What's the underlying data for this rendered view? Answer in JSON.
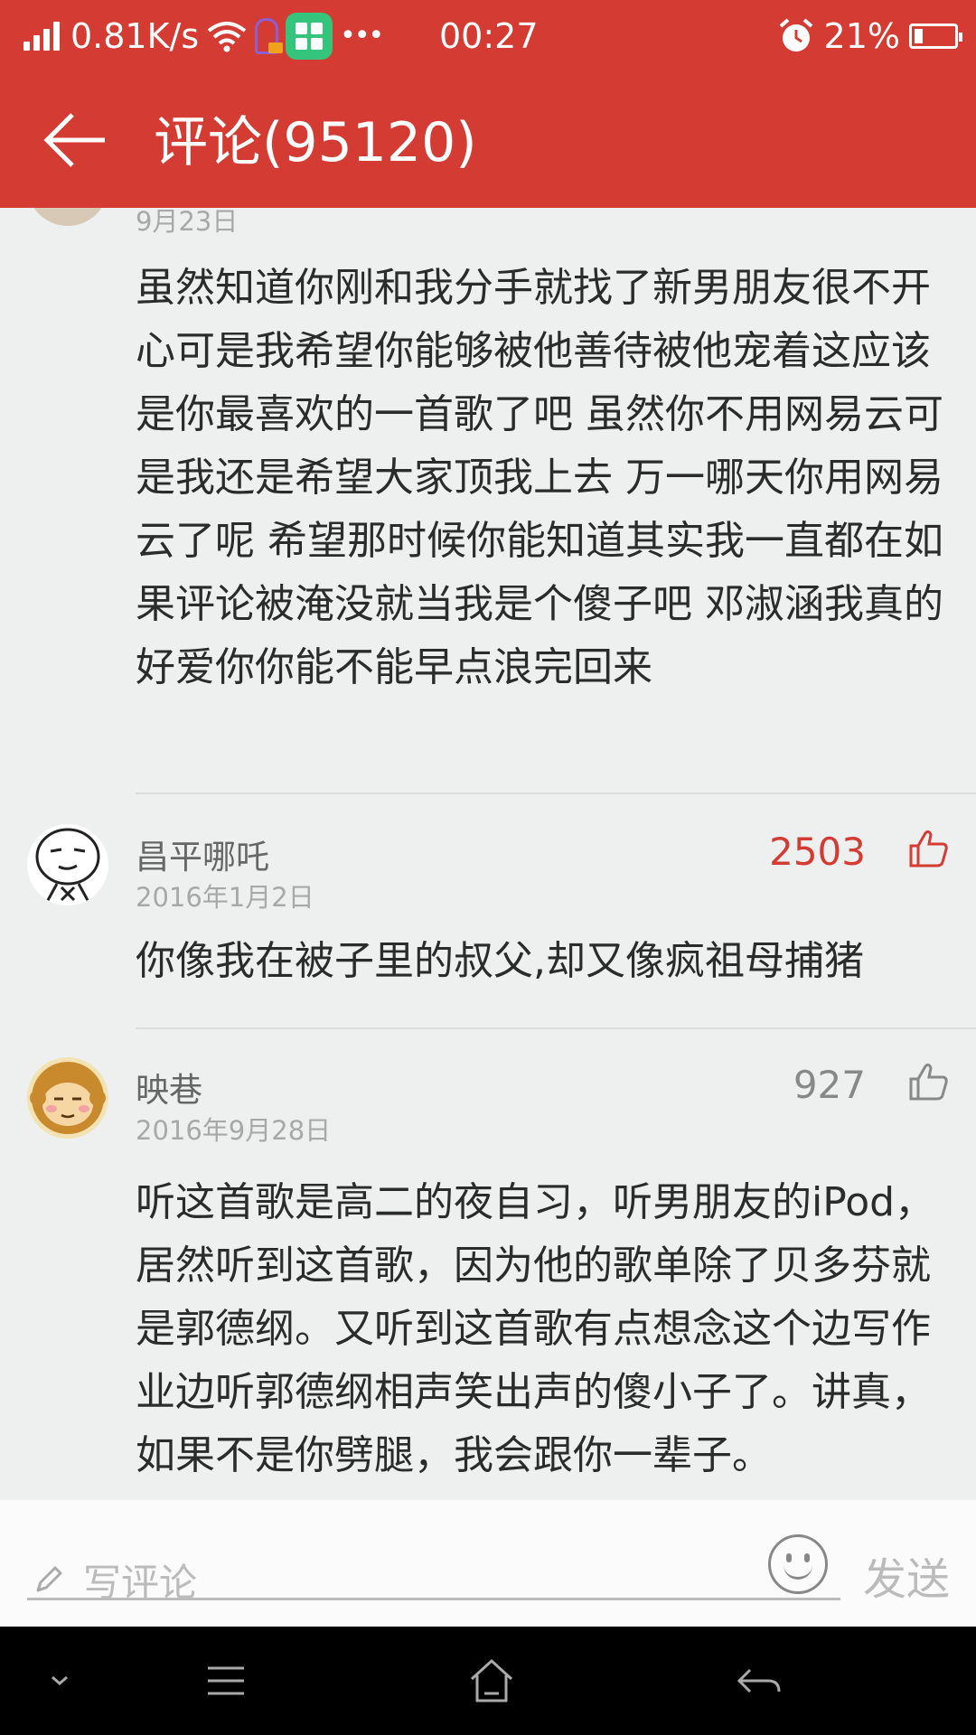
{
  "status_bar": {
    "net_speed": "0.81K/s",
    "more": "•••",
    "time": "00:27",
    "battery": "21%"
  },
  "header": {
    "title": "评论(95120)",
    "back_icon": "arrow-left-icon"
  },
  "comments": [
    {
      "date": "9月23日",
      "text": "虽然知道你刚和我分手就找了新男朋友很不开心可是我希望你能够被他善待被他宠着这应该是你最喜欢的一首歌了吧 虽然你不用网易云可是我还是希望大家顶我上去 万一哪天你用网易云了呢 希望那时候你能知道其实我一直都在如果评论被淹没就当我是个傻子吧 邓淑涵我真的好爱你你能不能早点浪完回来"
    },
    {
      "name": "昌平哪吒",
      "date": "2016年1月2日",
      "likes": "2503",
      "liked": true,
      "text": "你像我在被子里的叔父,却又像疯祖母捕猪"
    },
    {
      "name": "映巷",
      "date": "2016年9月28日",
      "likes": "927",
      "liked": false,
      "text": "听这首歌是高二的夜自习，听男朋友的iPod，居然听到这首歌，因为他的歌单除了贝多芬就是郭德纲。又听到这首歌有点想念这个边写作业边听郭德纲相声笑出声的傻小子了。讲真，如果不是你劈腿，我会跟你一辈子。"
    }
  ],
  "input_bar": {
    "placeholder": "写评论",
    "send_label": "发送"
  },
  "colors": {
    "brand_red": "#d43b33",
    "liked_red": "#d43b33",
    "like_gray": "#888888"
  }
}
